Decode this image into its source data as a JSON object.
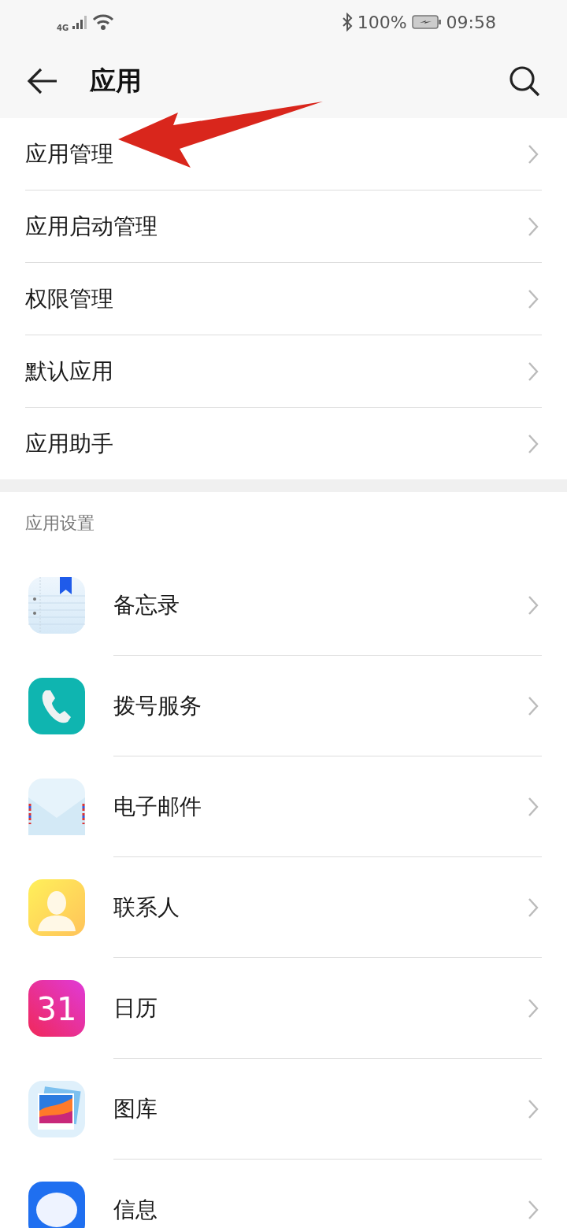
{
  "status_bar": {
    "network": "4G",
    "battery": "100%",
    "time": "09:58"
  },
  "header": {
    "title": "应用"
  },
  "menu_items": [
    {
      "label": "应用管理"
    },
    {
      "label": "应用启动管理"
    },
    {
      "label": "权限管理"
    },
    {
      "label": "默认应用"
    },
    {
      "label": "应用助手"
    }
  ],
  "section": {
    "title": "应用设置"
  },
  "apps": [
    {
      "label": "备忘录",
      "kind": "notes"
    },
    {
      "label": "拨号服务",
      "kind": "phone"
    },
    {
      "label": "电子邮件",
      "kind": "mail"
    },
    {
      "label": "联系人",
      "kind": "contacts"
    },
    {
      "label": "日历",
      "kind": "calendar",
      "icon_text": "31"
    },
    {
      "label": "图库",
      "kind": "gallery"
    },
    {
      "label": "信息",
      "kind": "messages"
    }
  ]
}
